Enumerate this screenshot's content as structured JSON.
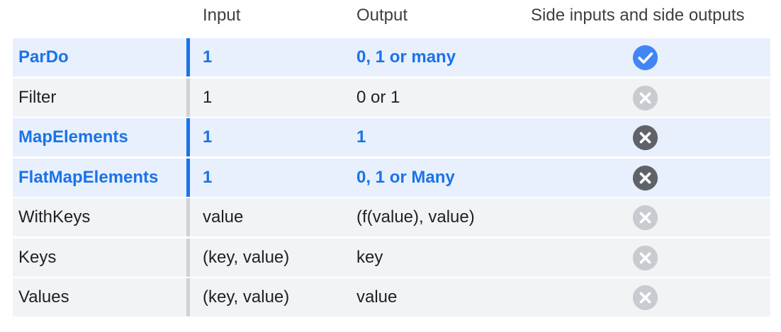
{
  "headers": {
    "input": "Input",
    "output": "Output",
    "side": "Side inputs and side outputs"
  },
  "colors": {
    "accent_blue": "#1a73e8",
    "check_blue": "#4285f4",
    "highlight_row_bg": "#e8f0fe",
    "plain_row_bg": "#f1f3f5",
    "dark_x": "#5f6368",
    "light_x": "#c8cbcf"
  },
  "rows": [
    {
      "name": "ParDo",
      "input": "1",
      "output": "0, 1 or many",
      "highlighted": true,
      "side_support": "check-icon"
    },
    {
      "name": "Filter",
      "input": "1",
      "output": "0 or 1",
      "highlighted": false,
      "side_support": "x-icon-light"
    },
    {
      "name": "MapElements",
      "input": "1",
      "output": "1",
      "highlighted": true,
      "side_support": "x-icon-dark"
    },
    {
      "name": "FlatMapElements",
      "input": "1",
      "output": "0, 1 or Many",
      "highlighted": true,
      "side_support": "x-icon-dark"
    },
    {
      "name": "WithKeys",
      "input": "value",
      "output": "(f(value), value)",
      "highlighted": false,
      "side_support": "x-icon-light"
    },
    {
      "name": "Keys",
      "input": "(key, value)",
      "output": "key",
      "highlighted": false,
      "side_support": "x-icon-light"
    },
    {
      "name": "Values",
      "input": "(key, value)",
      "output": "value",
      "highlighted": false,
      "side_support": "x-icon-light"
    }
  ]
}
